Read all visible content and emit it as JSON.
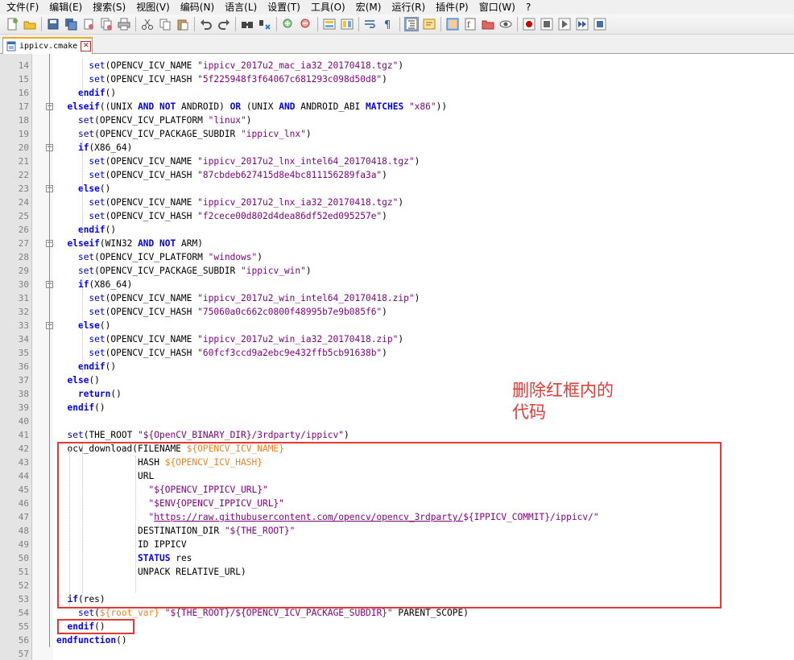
{
  "menu": [
    "文件(F)",
    "编辑(E)",
    "搜索(S)",
    "视图(V)",
    "编码(N)",
    "语言(L)",
    "设置(T)",
    "工具(O)",
    "宏(M)",
    "运行(R)",
    "插件(P)",
    "窗口(W)",
    "?"
  ],
  "toolbar_icons": [
    "new-file-icon",
    "open-file-icon",
    "save-icon",
    "save-all-icon",
    "close-icon",
    "close-all-icon",
    "print-icon",
    "cut-icon",
    "copy-icon",
    "paste-icon",
    "undo-icon",
    "redo-icon",
    "find-icon",
    "replace-icon",
    "zoom-in-icon",
    "zoom-out-icon",
    "sync-v-icon",
    "sync-h-icon",
    "word-wrap-icon",
    "show-all-chars-icon",
    "indent-guide-icon",
    "udl-icon",
    "doc-map-icon",
    "function-list-icon",
    "folder-workspace-icon",
    "monitoring-icon",
    "record-macro-icon",
    "stop-macro-icon",
    "play-macro-icon",
    "run-macro-multiple-icon",
    "save-macro-icon"
  ],
  "tab": {
    "filename": "ippicv.cmake"
  },
  "annotation": {
    "line1": "删除红框内的",
    "line2": "代码"
  },
  "lines": [
    {
      "n": "14",
      "t": "      set(OPENCV_ICV_NAME \"ippicv_2017u2_mac_ia32_20170418.tgz\")"
    },
    {
      "n": "15",
      "t": "      set(OPENCV_ICV_HASH \"5f225948f3f64067c681293c098d50d8\")"
    },
    {
      "n": "16",
      "t": "    endif()"
    },
    {
      "n": "17",
      "t": "  elseif((UNIX AND NOT ANDROID) OR (UNIX AND ANDROID_ABI MATCHES \"x86\"))"
    },
    {
      "n": "18",
      "t": "    set(OPENCV_ICV_PLATFORM \"linux\")"
    },
    {
      "n": "19",
      "t": "    set(OPENCV_ICV_PACKAGE_SUBDIR \"ippicv_lnx\")"
    },
    {
      "n": "20",
      "t": "    if(X86_64)"
    },
    {
      "n": "21",
      "t": "      set(OPENCV_ICV_NAME \"ippicv_2017u2_lnx_intel64_20170418.tgz\")"
    },
    {
      "n": "22",
      "t": "      set(OPENCV_ICV_HASH \"87cbdeb627415d8e4bc811156289fa3a\")"
    },
    {
      "n": "23",
      "t": "    else()"
    },
    {
      "n": "24",
      "t": "      set(OPENCV_ICV_NAME \"ippicv_2017u2_lnx_ia32_20170418.tgz\")"
    },
    {
      "n": "25",
      "t": "      set(OPENCV_ICV_HASH \"f2cece00d802d4dea86df52ed095257e\")"
    },
    {
      "n": "26",
      "t": "    endif()"
    },
    {
      "n": "27",
      "t": "  elseif(WIN32 AND NOT ARM)"
    },
    {
      "n": "28",
      "t": "    set(OPENCV_ICV_PLATFORM \"windows\")"
    },
    {
      "n": "29",
      "t": "    set(OPENCV_ICV_PACKAGE_SUBDIR \"ippicv_win\")"
    },
    {
      "n": "30",
      "t": "    if(X86_64)"
    },
    {
      "n": "31",
      "t": "      set(OPENCV_ICV_NAME \"ippicv_2017u2_win_intel64_20170418.zip\")"
    },
    {
      "n": "32",
      "t": "      set(OPENCV_ICV_HASH \"75060a0c662c0800f48995b7e9b085f6\")"
    },
    {
      "n": "33",
      "t": "    else()"
    },
    {
      "n": "34",
      "t": "      set(OPENCV_ICV_NAME \"ippicv_2017u2_win_ia32_20170418.zip\")"
    },
    {
      "n": "35",
      "t": "      set(OPENCV_ICV_HASH \"60fcf3ccd9a2ebc9e432ffb5cb91638b\")"
    },
    {
      "n": "36",
      "t": "    endif()"
    },
    {
      "n": "37",
      "t": "  else()"
    },
    {
      "n": "38",
      "t": "    return()"
    },
    {
      "n": "39",
      "t": "  endif()"
    },
    {
      "n": "40",
      "t": ""
    },
    {
      "n": "41",
      "t": "  set(THE_ROOT \"${OpenCV_BINARY_DIR}/3rdparty/ippicv\")"
    },
    {
      "n": "42",
      "t": "  ocv_download(FILENAME ${OPENCV_ICV_NAME}"
    },
    {
      "n": "43",
      "t": "               HASH ${OPENCV_ICV_HASH}"
    },
    {
      "n": "44",
      "t": "               URL"
    },
    {
      "n": "45",
      "t": "                 \"${OPENCV_IPPICV_URL}\""
    },
    {
      "n": "46",
      "t": "                 \"$ENV{OPENCV_IPPICV_URL}\""
    },
    {
      "n": "47",
      "t": "                 \"https://raw.githubusercontent.com/opencv/opencv_3rdparty/${IPPICV_COMMIT}/ippicv/\""
    },
    {
      "n": "48",
      "t": "               DESTINATION_DIR \"${THE_ROOT}\""
    },
    {
      "n": "49",
      "t": "               ID IPPICV"
    },
    {
      "n": "50",
      "t": "               STATUS res"
    },
    {
      "n": "51",
      "t": "               UNPACK RELATIVE_URL)"
    },
    {
      "n": "52",
      "t": ""
    },
    {
      "n": "53",
      "t": "  if(res)"
    },
    {
      "n": "54",
      "t": "    set(${root_var} \"${THE_ROOT}/${OPENCV_ICV_PACKAGE_SUBDIR}\" PARENT_SCOPE)"
    },
    {
      "n": "55",
      "t": "  endif()"
    },
    {
      "n": "56",
      "t": "endfunction()"
    },
    {
      "n": "57",
      "t": ""
    }
  ]
}
